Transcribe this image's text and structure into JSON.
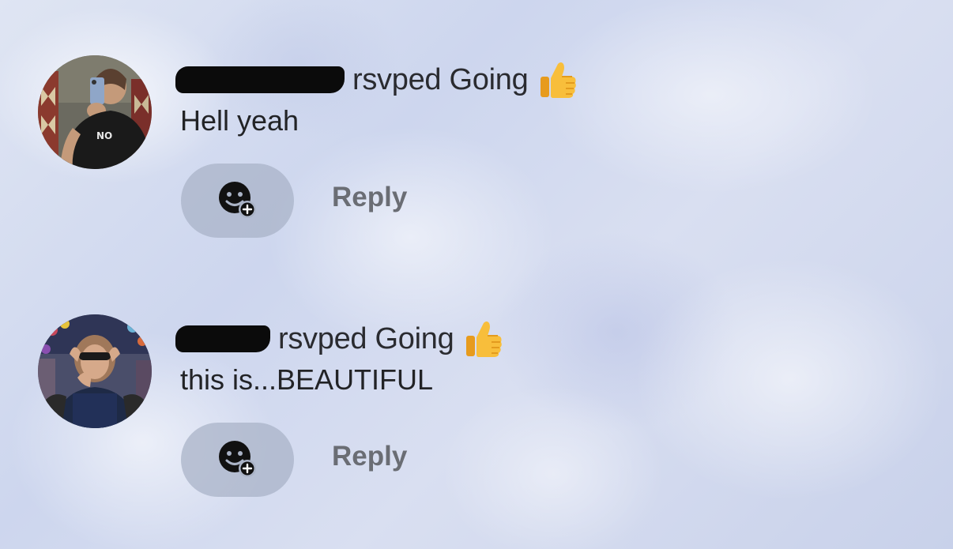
{
  "comments": [
    {
      "action": "rsvped Going",
      "text": "Hell yeah",
      "reaction_icon": "thumbs-up-emoji",
      "reply_label": "Reply",
      "add_reaction_icon": "add-reaction-icon"
    },
    {
      "action": "rsvped Going",
      "text": "this is...BEAUTIFUL",
      "reaction_icon": "thumbs-up-emoji",
      "reply_label": "Reply",
      "add_reaction_icon": "add-reaction-icon"
    }
  ],
  "colors": {
    "text": "#222326",
    "reply": "#6a6d74",
    "pill": "#a8b2c6",
    "redaction": "#0b0b0b",
    "thumb": "#f6b93b"
  }
}
